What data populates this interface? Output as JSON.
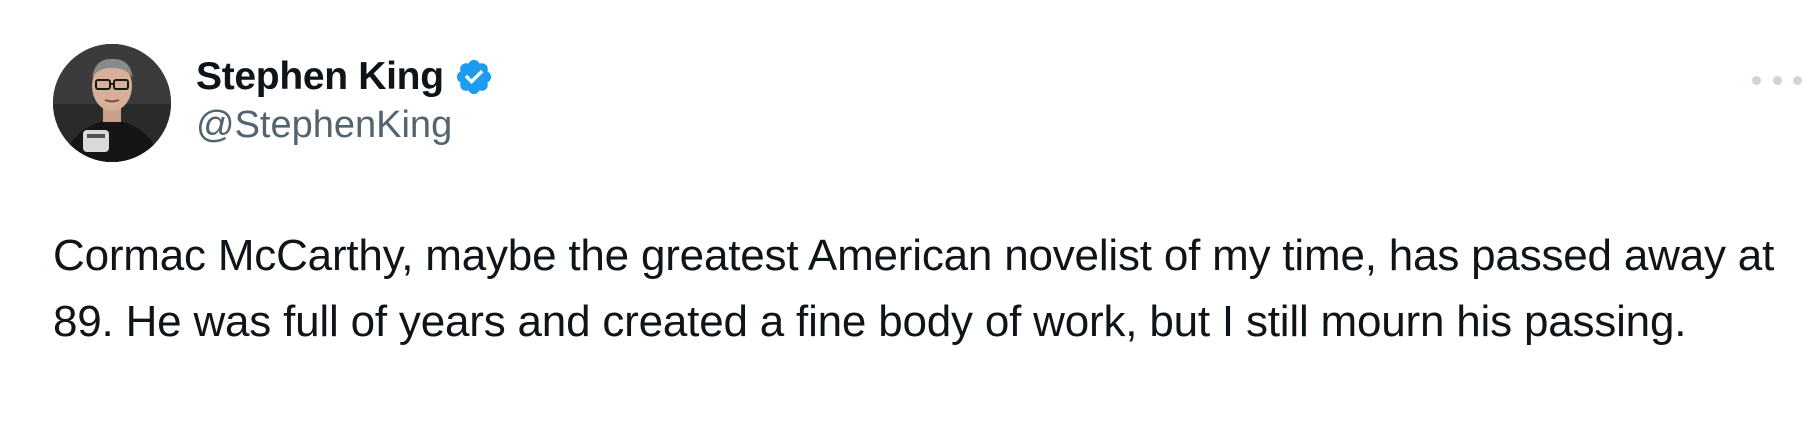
{
  "author": {
    "display_name": "Stephen King",
    "handle": "@StephenKing",
    "verified": true
  },
  "tweet": {
    "text": "Cormac McCarthy, maybe the greatest American novelist of my time, has passed away at 89. He was full of years and created a fine body of work, but I still mourn his passing."
  },
  "icons": {
    "verified": "verified-badge-icon",
    "more": "more-options-icon"
  },
  "colors": {
    "text": "#0f1419",
    "secondary_text": "#536471",
    "verified_blue": "#1d9bf0"
  }
}
